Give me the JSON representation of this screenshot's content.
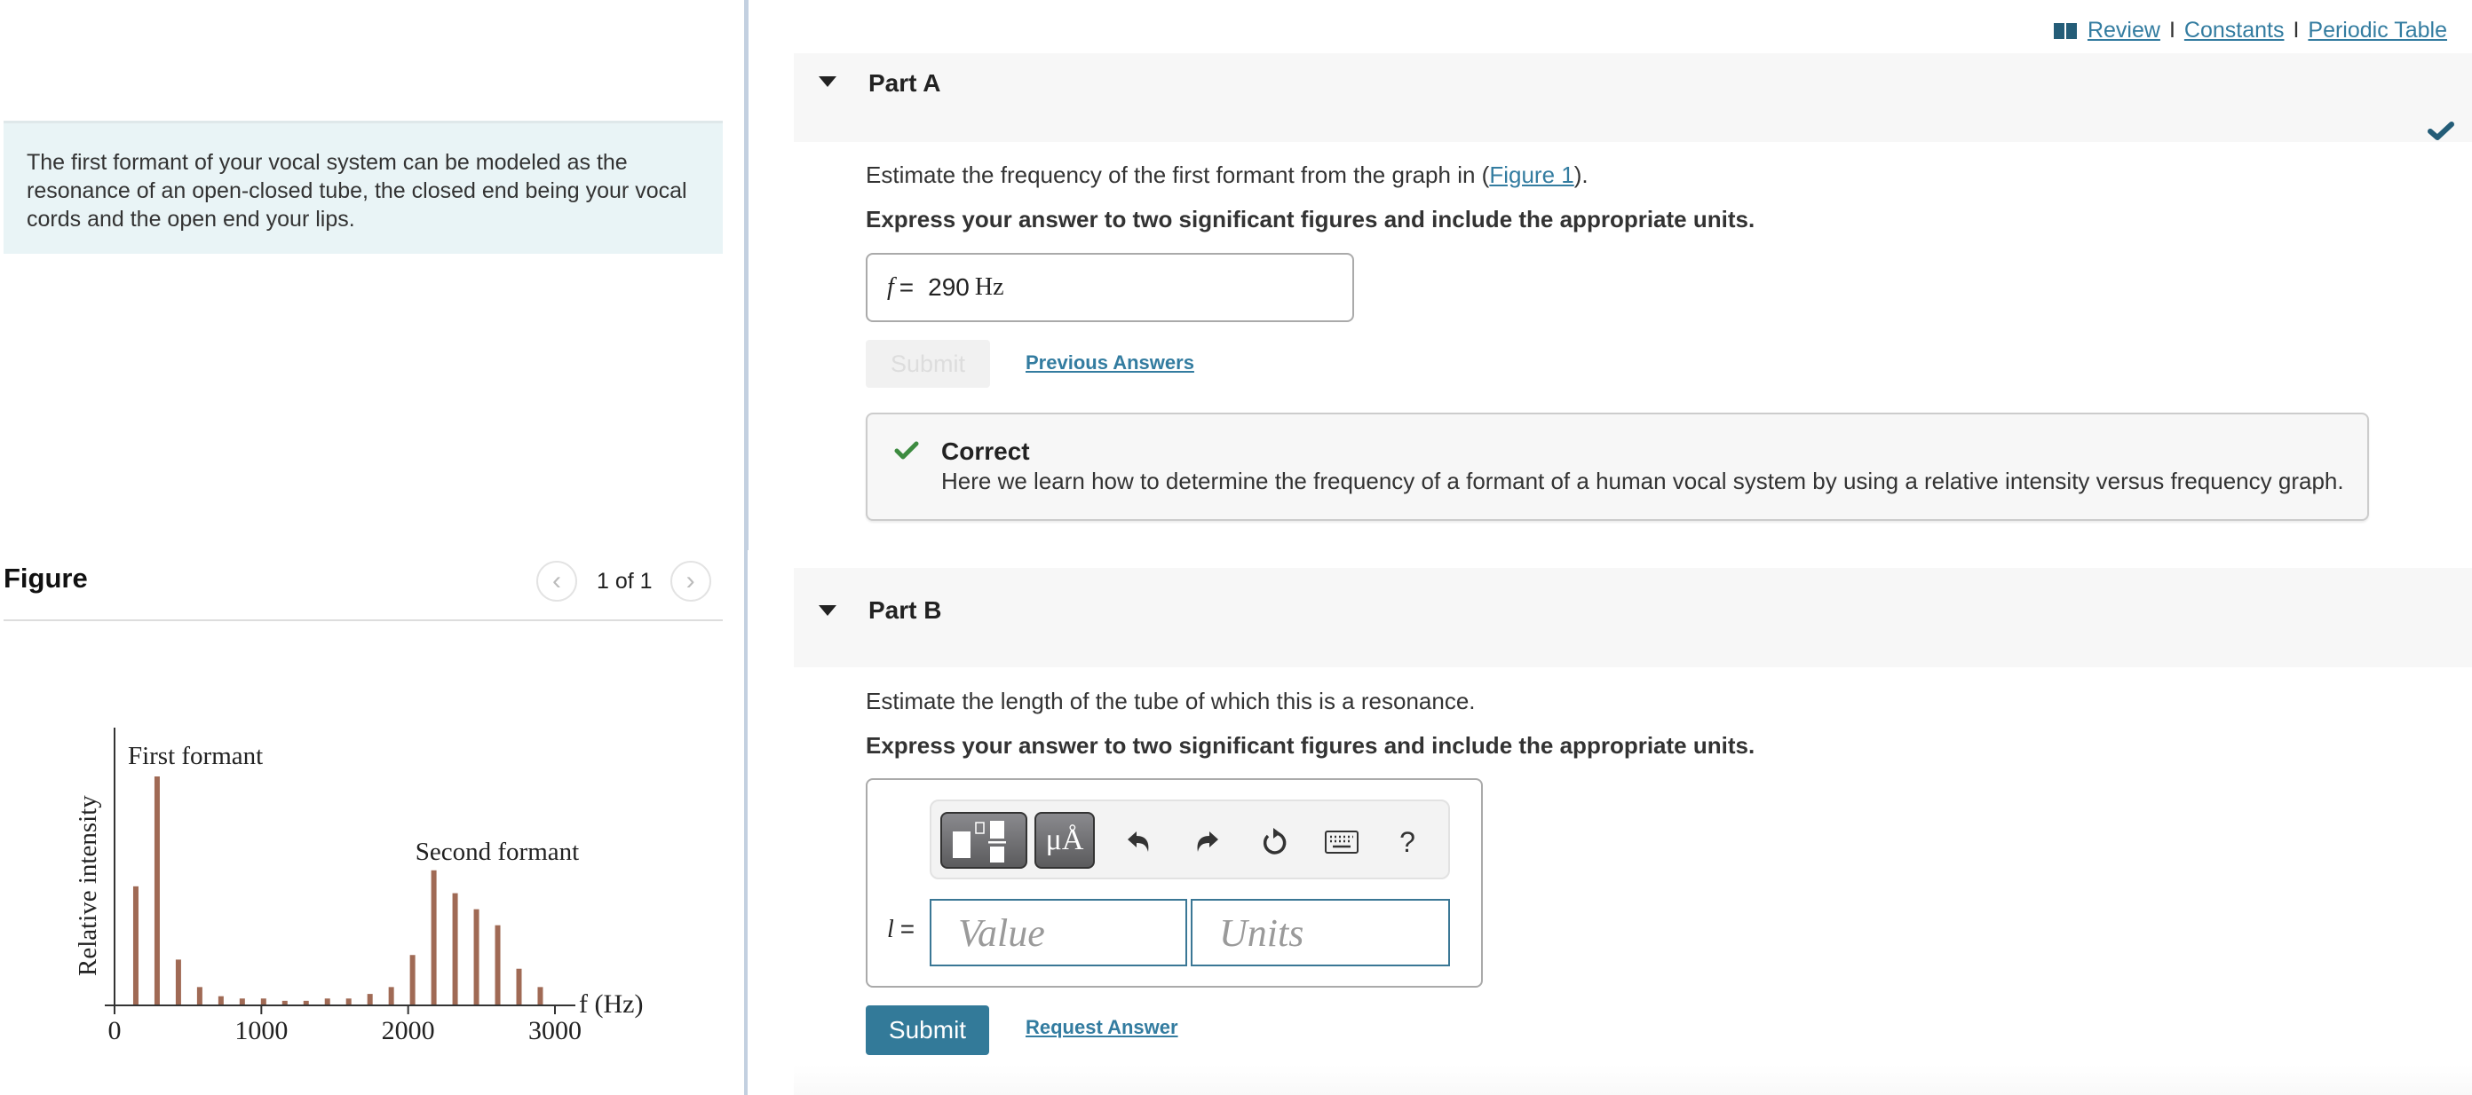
{
  "top_links": {
    "review": "Review",
    "separator": "I",
    "constants": "Constants",
    "periodic_table": "Periodic Table"
  },
  "intro_text": "The first formant of your vocal system can be modeled as the resonance of an open-closed tube, the closed end being your vocal cords and the open end your lips.",
  "figure": {
    "title": "Figure",
    "counter": "1 of 1",
    "prev_icon": "chevron-left-icon",
    "next_icon": "chevron-right-icon"
  },
  "chart_data": {
    "type": "bar",
    "title": "",
    "xlabel": "f (Hz)",
    "ylabel": "Relative intensity",
    "xlim": [
      0,
      3000
    ],
    "ylim": [
      0,
      1
    ],
    "x_ticks": [
      0,
      1000,
      2000,
      3000
    ],
    "x_tick_labels": [
      "0",
      "1000",
      "2000",
      "3000"
    ],
    "grid": false,
    "annotations": [
      {
        "text": "First formant",
        "x": 290
      },
      {
        "text": "Second formant",
        "x": 2170
      }
    ],
    "x": [
      145,
      290,
      435,
      580,
      725,
      870,
      1015,
      1160,
      1305,
      1450,
      1595,
      1740,
      1885,
      2030,
      2175,
      2320,
      2465,
      2610,
      2755,
      2900
    ],
    "values": [
      0.52,
      1.0,
      0.2,
      0.08,
      0.04,
      0.03,
      0.03,
      0.02,
      0.02,
      0.03,
      0.03,
      0.05,
      0.08,
      0.22,
      0.59,
      0.49,
      0.42,
      0.35,
      0.16,
      0.08
    ],
    "bar_color": "#a06a55"
  },
  "part_a": {
    "title": "Part A",
    "question": "Estimate the frequency of the first formant from the graph in (",
    "figure_link": "Figure 1",
    "question_end": ").",
    "instruction": "Express your answer to two significant figures and include the appropriate units.",
    "variable": "f",
    "equals": "=",
    "answer_value": "290",
    "answer_units": "Hz",
    "submit_label": "Submit",
    "previous_answers_label": "Previous Answers",
    "feedback": {
      "title": "Correct",
      "text": "Here we learn how to determine the frequency of a formant of a human vocal system by using a relative intensity versus frequency graph."
    }
  },
  "part_b": {
    "title": "Part B",
    "question": "Estimate the length of the tube of which this is a resonance.",
    "instruction": "Express your answer to two significant figures and include the appropriate units.",
    "variable": "l",
    "equals": "=",
    "value_placeholder": "Value",
    "units_placeholder": "Units",
    "toolbar": {
      "units_label": "μÅ",
      "help_label": "?"
    },
    "submit_label": "Submit",
    "request_answer_label": "Request Answer"
  },
  "colors": {
    "link": "#337ca0",
    "primary_button": "#337a99",
    "correct_green": "#3d8b40",
    "check_dark": "#245d78",
    "intro_bg": "#e9f4f6"
  }
}
